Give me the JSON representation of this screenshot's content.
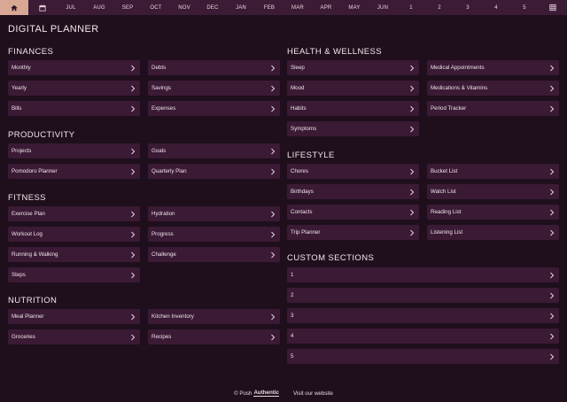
{
  "nav": {
    "months": [
      "JUL",
      "AUG",
      "SEP",
      "OCT",
      "NOV",
      "DEC",
      "JAN",
      "FEB",
      "MAR",
      "APR",
      "MAY",
      "JUN"
    ],
    "weeks": [
      "1",
      "2",
      "3",
      "4",
      "5"
    ]
  },
  "page_title": "DIGITAL PLANNER",
  "finances": {
    "title": "FINANCES",
    "items": [
      "Monthly",
      "Debts",
      "Yearly",
      "Savings",
      "Bills",
      "Expenses"
    ]
  },
  "productivity": {
    "title": "PRODUCTIVITY",
    "items": [
      "Projects",
      "Goals",
      "Pomodoro Planner",
      "Quarterly Plan"
    ]
  },
  "fitness": {
    "title": "FITNESS",
    "items": [
      "Exercise Plan",
      "Hydration",
      "Workout Log",
      "Progress",
      "Running & Walking",
      "Challenge",
      "Steps"
    ]
  },
  "nutrition": {
    "title": "NUTRITION",
    "items": [
      "Meal Planner",
      "Kitchen Inventory",
      "Groceries",
      "Recipes"
    ]
  },
  "health": {
    "title": "HEALTH & WELLNESS",
    "items": [
      "Sleep",
      "Medical Appointments",
      "Mood",
      "Medications & Vitamins",
      "Habits",
      "Period Tracker",
      "Symptoms"
    ]
  },
  "lifestyle": {
    "title": "LIFESTYLE",
    "items": [
      "Chores",
      "Bucket List",
      "Birthdays",
      "Watch List",
      "Contacts",
      "Reading List",
      "Trip Planner",
      "Listening List"
    ]
  },
  "custom": {
    "title": "CUSTOM SECTIONS",
    "items": [
      "1",
      "2",
      "3",
      "4",
      "5"
    ]
  },
  "footer": {
    "copyright": "© Posh",
    "brand": "Authentic",
    "link": "Visit our website"
  },
  "colors": {
    "background": "#1f0f1d",
    "tile": "#3a1a34",
    "nav": "#3b1b36",
    "home_accent": "#d9a894"
  }
}
